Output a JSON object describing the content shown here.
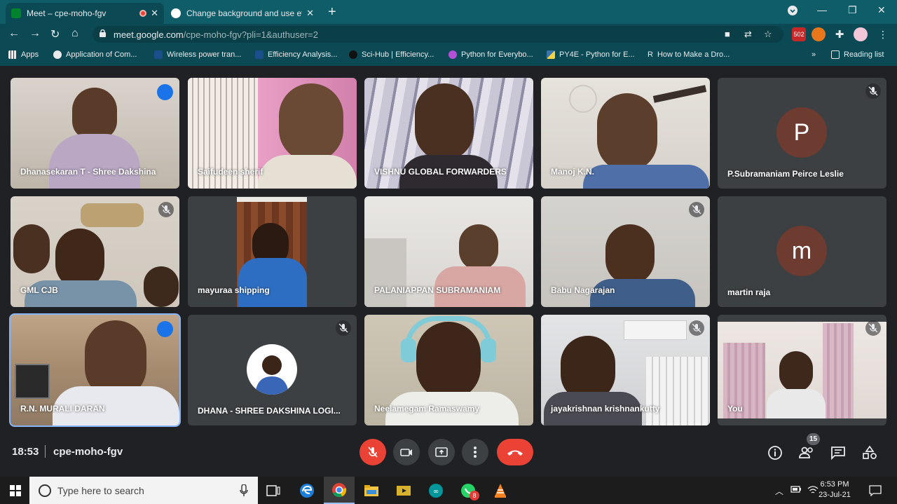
{
  "browser": {
    "tabs": [
      {
        "title": "Meet – cpe-moho-fgv",
        "active": true,
        "recording": true
      },
      {
        "title": "Change background and use effe",
        "active": false
      }
    ],
    "url_host": "meet.google.com",
    "url_path": "/cpe-moho-fgv?pli=1&authuser=2",
    "extension_badge": "502",
    "bookmarks": [
      "Apps",
      "Application of Com...",
      "Wireless power tran...",
      "Efficiency Analysis...",
      "Sci-Hub | Efficiency...",
      "Python for Everybo...",
      "PY4E - Python for E...",
      "How to Make a Dro..."
    ],
    "bookmarks_overflow": "»",
    "reading_list": "Reading list"
  },
  "participants": [
    {
      "name": "Dhanasekaran T - Shree Dakshina",
      "state": "speaking"
    },
    {
      "name": "Saifudeen sherif",
      "state": "video"
    },
    {
      "name": "VISHNU GLOBAL FORWARDERS",
      "state": "video"
    },
    {
      "name": "Manoj K.N.",
      "state": "video"
    },
    {
      "name": "P.Subramaniam Peirce Leslie",
      "state": "muted",
      "initial": "P"
    },
    {
      "name": "GML CJB",
      "state": "muted"
    },
    {
      "name": "mayuraa shipping",
      "state": "video"
    },
    {
      "name": "PALANIAPPAN SUBRAMANIAM",
      "state": "video"
    },
    {
      "name": "Babu Nagarajan",
      "state": "muted"
    },
    {
      "name": "martin raja",
      "state": "video",
      "initial": "m"
    },
    {
      "name": "R.N. MURALI DARAN",
      "state": "speaking"
    },
    {
      "name": "DHANA - SHREE DAKSHINA LOGI...",
      "state": "muted"
    },
    {
      "name": "Neelamegam Ramaswamy",
      "state": "video"
    },
    {
      "name": "jayakrishnan krishnankutty",
      "state": "muted"
    },
    {
      "name": "You",
      "state": "muted"
    }
  ],
  "meeting": {
    "time": "18:53",
    "separator": "|",
    "code": "cpe-moho-fgv",
    "people_count": "15"
  },
  "taskbar": {
    "search_placeholder": "Type here to search",
    "whatsapp_badge": "8",
    "clock_time": "6:53 PM",
    "clock_date": "23-Jul-21"
  }
}
